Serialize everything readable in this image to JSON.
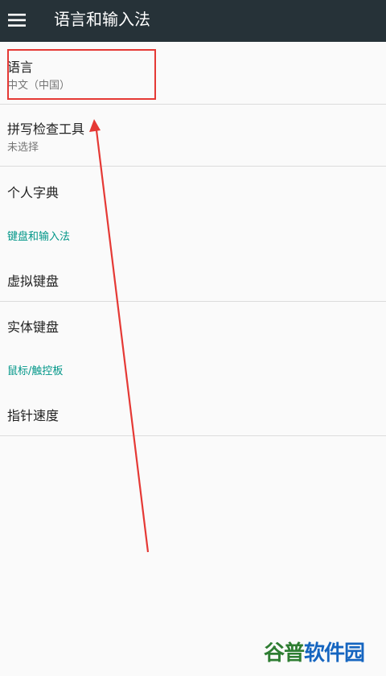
{
  "toolbar": {
    "title": "语言和输入法",
    "menu_icon": "hamburger-menu-icon",
    "background_color": "#263238"
  },
  "list": {
    "language": {
      "title": "语言",
      "summary": "中文（中国）"
    },
    "spell_checker": {
      "title": "拼写检查工具",
      "summary": "未选择"
    },
    "personal_dictionary": {
      "title": "个人字典"
    },
    "category_keyboard": "键盘和输入法",
    "virtual_keyboard": {
      "title": "虚拟键盘"
    },
    "physical_keyboard": {
      "title": "实体键盘"
    },
    "category_mouse": "鼠标/触控板",
    "pointer_speed": {
      "title": "指针速度"
    }
  },
  "colors": {
    "accent": "#009688",
    "annotation": "#e53935"
  },
  "watermark": {
    "text_part1": "谷普",
    "text_part2": "软件园"
  }
}
